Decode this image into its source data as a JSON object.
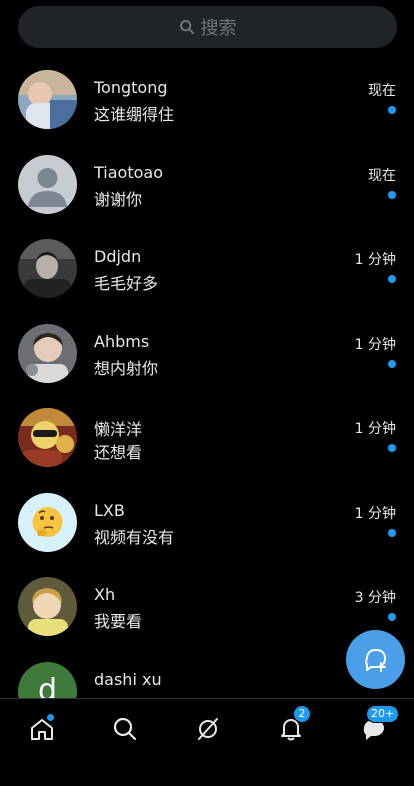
{
  "search": {
    "placeholder": "搜索"
  },
  "conversations": [
    {
      "name": "Tongtong",
      "preview": "这谁绷得住",
      "time": "现在",
      "unread": true,
      "avatar": "photo-child-icon"
    },
    {
      "name": "Tiaotoao",
      "preview": "谢谢你",
      "time": "现在",
      "unread": true,
      "avatar": "default-user-icon"
    },
    {
      "name": "Ddjdn",
      "preview": "毛毛好多",
      "time": "1 分钟",
      "unread": true,
      "avatar": "photo-man-icon"
    },
    {
      "name": "Ahbms",
      "preview": "想内射你",
      "time": "1 分钟",
      "unread": true,
      "avatar": "photo-boy-icon"
    },
    {
      "name": "懒洋洋",
      "preview": "还想看",
      "time": "1 分钟",
      "unread": true,
      "avatar": "photo-costume-icon"
    },
    {
      "name": "LXB",
      "preview": "视频有没有",
      "time": "1 分钟",
      "unread": true,
      "avatar": "thinking-face-icon"
    },
    {
      "name": "Xh",
      "preview": "我要看",
      "time": "3 分钟",
      "unread": true,
      "avatar": "photo-blond-child-icon"
    },
    {
      "name": "dashi xu",
      "preview": "",
      "time": "",
      "unread": false,
      "avatar": "letter-avatar-icon",
      "avatar_letter": "d"
    }
  ],
  "nav": {
    "items": [
      "home-icon",
      "search-icon",
      "grok-icon",
      "notifications-icon",
      "messages-icon"
    ],
    "notifications_badge": "2",
    "messages_badge": "20+"
  },
  "colors": {
    "accent": "#1d9bf0",
    "fab": "#4a9fe8",
    "background": "#000000",
    "search_bg": "#202327"
  }
}
